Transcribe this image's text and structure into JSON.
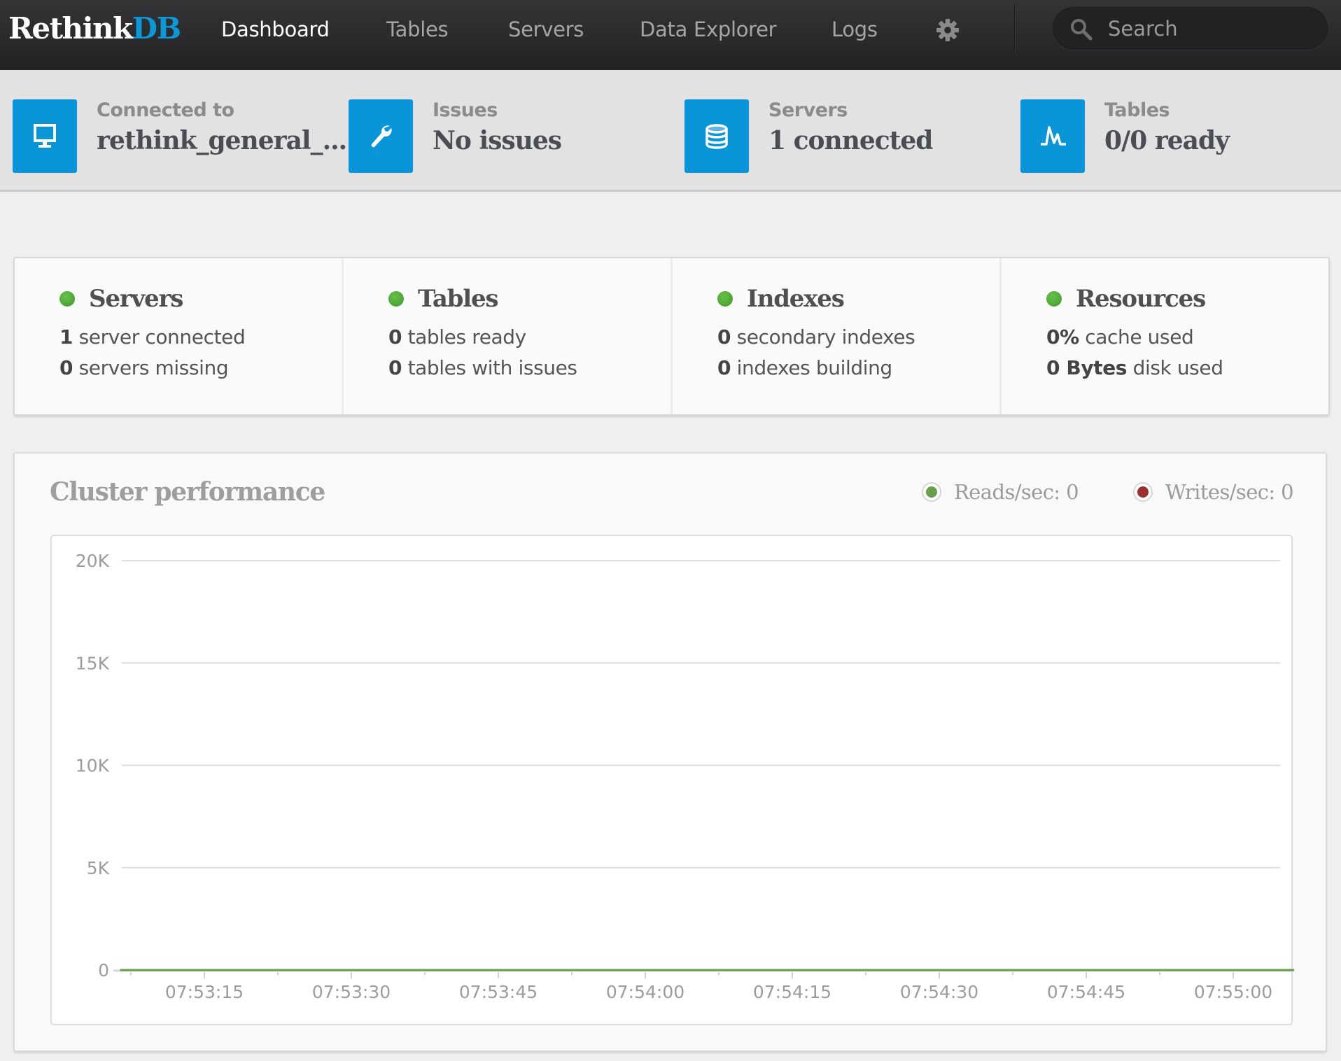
{
  "navbar": {
    "brand_main": "Rethink",
    "brand_accent": "DB",
    "items": [
      {
        "label": "Dashboard",
        "active": true
      },
      {
        "label": "Tables",
        "active": false
      },
      {
        "label": "Servers",
        "active": false
      },
      {
        "label": "Data Explorer",
        "active": false
      },
      {
        "label": "Logs",
        "active": false
      }
    ],
    "settings_icon": "gear-icon",
    "search": {
      "placeholder": "Search",
      "value": "",
      "icon": "search-icon"
    }
  },
  "status_bar": {
    "items": [
      {
        "label": "Connected to",
        "value": "rethink_general_...",
        "icon": "monitor-icon"
      },
      {
        "label": "Issues",
        "value": "No issues",
        "icon": "wrench-icon"
      },
      {
        "label": "Servers",
        "value": "1 connected",
        "icon": "database-icon"
      },
      {
        "label": "Tables",
        "value": "0/0 ready",
        "icon": "pulse-icon"
      }
    ],
    "icon_color": "#0896d8"
  },
  "stats": [
    {
      "title": "Servers",
      "status_color": "#4caf2e",
      "lines": [
        {
          "num": "1",
          "text": " server connected"
        },
        {
          "num": "0",
          "text": " servers missing"
        }
      ]
    },
    {
      "title": "Tables",
      "status_color": "#4caf2e",
      "lines": [
        {
          "num": "0",
          "text": " tables ready"
        },
        {
          "num": "0",
          "text": " tables with issues"
        }
      ]
    },
    {
      "title": "Indexes",
      "status_color": "#4caf2e",
      "lines": [
        {
          "num": "0",
          "text": " secondary indexes"
        },
        {
          "num": "0",
          "text": " indexes building"
        }
      ]
    },
    {
      "title": "Resources",
      "status_color": "#4caf2e",
      "lines": [
        {
          "num": "0%",
          "text": " cache used"
        },
        {
          "num": "0 Bytes",
          "text": " disk used"
        }
      ]
    }
  ],
  "performance": {
    "title": "Cluster performance",
    "legend": [
      {
        "label": "Reads/sec: 0",
        "color": "#6a9f4a"
      },
      {
        "label": "Writes/sec: 0",
        "color": "#9b2f2f"
      }
    ]
  },
  "chart_data": {
    "type": "line",
    "title": "Cluster performance",
    "xlabel": "",
    "ylabel": "",
    "ylim": [
      0,
      20000
    ],
    "yticks": [
      0,
      5000,
      10000,
      15000,
      20000
    ],
    "ytick_labels": [
      "0",
      "5K",
      "10K",
      "15K",
      "20K"
    ],
    "xticks": [
      "07:53:15",
      "07:53:30",
      "07:53:45",
      "07:54:00",
      "07:54:15",
      "07:54:30",
      "07:54:45",
      "07:55:00"
    ],
    "xlim_seconds_from_075315": [
      -8.6,
      124.8
    ],
    "grid": "horizontal",
    "legend_position": "top-right",
    "series": [
      {
        "name": "Reads/sec",
        "color": "#6a9f4a",
        "x_seconds_from_075315": [
          -8.6,
          124.8
        ],
        "values": [
          0,
          0
        ]
      },
      {
        "name": "Writes/sec",
        "color": "#9b2f2f",
        "x_seconds_from_075315": [
          -8.6,
          124.8
        ],
        "values": [
          0,
          0
        ]
      }
    ]
  }
}
